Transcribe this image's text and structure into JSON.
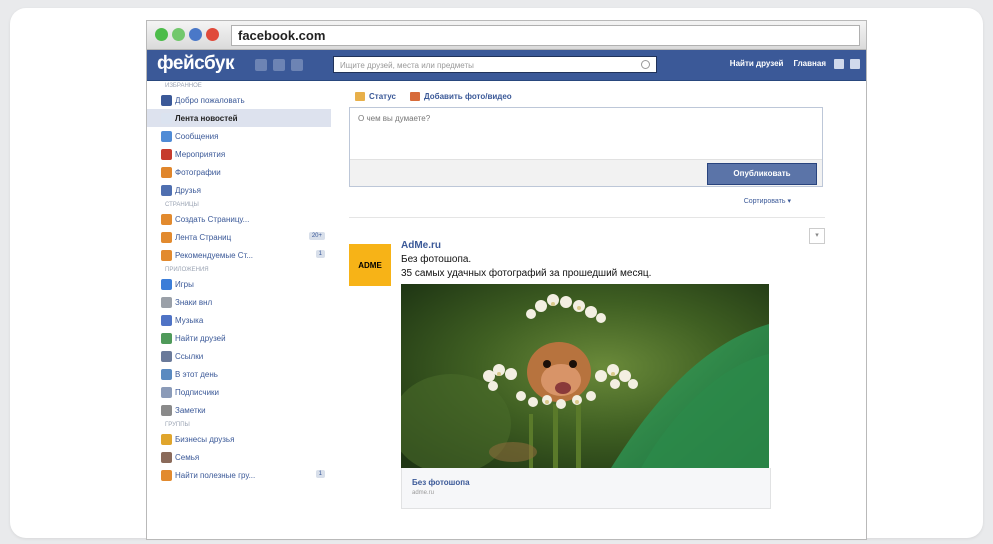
{
  "browser": {
    "url": "facebook.com"
  },
  "header": {
    "logo": "фейсбук",
    "search_placeholder": "Ищите друзей, места или предметы",
    "links": [
      "Найти друзей",
      "Главная"
    ]
  },
  "sidebar": {
    "sections": [
      {
        "head": "Избранное",
        "items": [
          {
            "label": "Добро пожаловать",
            "icon": "fb-icon",
            "color": "#3b5998"
          },
          {
            "label": "Лента новостей",
            "icon": "news-feed-icon",
            "color": "#dbe3f0",
            "active": true
          },
          {
            "label": "Сообщения",
            "icon": "messages-icon",
            "color": "#4f8bd6"
          },
          {
            "label": "Мероприятия",
            "icon": "calendar-icon",
            "color": "#c63b2d"
          },
          {
            "label": "Фотографии",
            "icon": "photos-icon",
            "color": "#e0862c"
          },
          {
            "label": "Друзья",
            "icon": "friends-icon",
            "color": "#4f6fb0"
          }
        ]
      },
      {
        "head": "Страницы",
        "items": [
          {
            "label": "Создать Страницу...",
            "icon": "flag-icon",
            "color": "#e28a2e"
          },
          {
            "label": "Лента Страниц",
            "icon": "pages-feed-icon",
            "color": "#e28a2e",
            "badge": "20+"
          },
          {
            "label": "Рекомендуемые Ст...",
            "icon": "pages-recommended-icon",
            "color": "#e28a2e",
            "badge": "1"
          }
        ]
      },
      {
        "head": "Приложения",
        "items": [
          {
            "label": "Игры",
            "icon": "games-icon",
            "color": "#3b7dd8"
          },
          {
            "label": "Знаки внл",
            "icon": "gear-icon",
            "color": "#9aa0a8"
          },
          {
            "label": "Музыка",
            "icon": "music-icon",
            "color": "#4f73c5"
          },
          {
            "label": "Найти друзей",
            "icon": "find-friends-icon",
            "color": "#4f9a5a"
          },
          {
            "label": "Ссылки",
            "icon": "links-icon",
            "color": "#6a7a9a"
          },
          {
            "label": "В этот день",
            "icon": "clock-icon",
            "color": "#5a8ac0"
          },
          {
            "label": "Подписчики",
            "icon": "followers-icon",
            "color": "#8b9bb8"
          },
          {
            "label": "Заметки",
            "icon": "notes-icon",
            "color": "#8a8a8a"
          }
        ]
      },
      {
        "head": "Группы",
        "items": [
          {
            "label": "Бизнесы друзья",
            "icon": "groups-icon",
            "color": "#e0a52c"
          },
          {
            "label": "Семья",
            "icon": "family-icon",
            "color": "#8a6a5a"
          },
          {
            "label": "Найти полезные гру...",
            "icon": "find-groups-icon",
            "color": "#e28a2e",
            "badge": "1"
          }
        ]
      }
    ]
  },
  "composer": {
    "tab_status": "Статус",
    "tab_photo": "Добавить фото/видео",
    "placeholder": "О чем вы думаете?",
    "post_button": "Опубликовать",
    "sort": "Сортировать"
  },
  "post": {
    "avatar_text": "ADME",
    "author": "AdMe.ru",
    "line1": "Без фотошопа.",
    "line2": "35 самых удачных фотографий за прошедший месяц.",
    "link_title": "Без фотошопа",
    "link_domain": "adme.ru"
  }
}
